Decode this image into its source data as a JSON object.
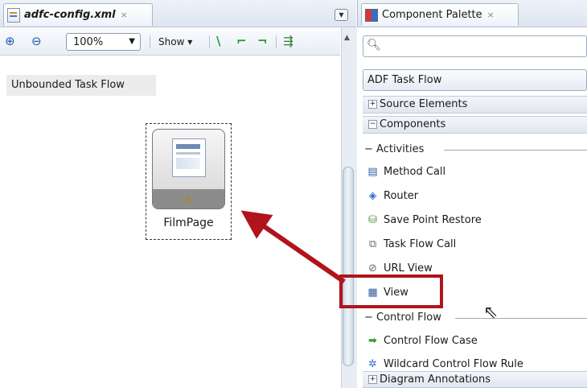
{
  "editor": {
    "tab_title": "adfc-config.xml",
    "tab_close": "×",
    "zoom_value": "100%",
    "show_label": "Show ▾",
    "diagram_label": "Unbounded Task Flow",
    "activity_name": "FilmPage"
  },
  "palette": {
    "tab_title": "Component Palette",
    "tab_close": "×",
    "search_placeholder": "",
    "library": "ADF Task Flow",
    "source_elements": "Source Elements",
    "components": "Components",
    "activities_header": "Activities",
    "activities": [
      {
        "label": "Method Call",
        "icon": "method-call-icon"
      },
      {
        "label": "Router",
        "icon": "router-icon"
      },
      {
        "label": "Save Point Restore",
        "icon": "save-point-restore-icon"
      },
      {
        "label": "Task Flow Call",
        "icon": "task-flow-call-icon"
      },
      {
        "label": "URL View",
        "icon": "url-view-icon"
      },
      {
        "label": "View",
        "icon": "view-icon"
      }
    ],
    "control_flow_header": "Control Flow",
    "control_flow": [
      {
        "label": "Control Flow Case",
        "icon": "control-flow-case-icon"
      },
      {
        "label": "Wildcard Control Flow Rule",
        "icon": "wildcard-rule-icon"
      }
    ],
    "diagram_annotations": "Diagram Annotations"
  },
  "colors": {
    "highlight": "#b0141c",
    "arrow": "#b0141c"
  }
}
